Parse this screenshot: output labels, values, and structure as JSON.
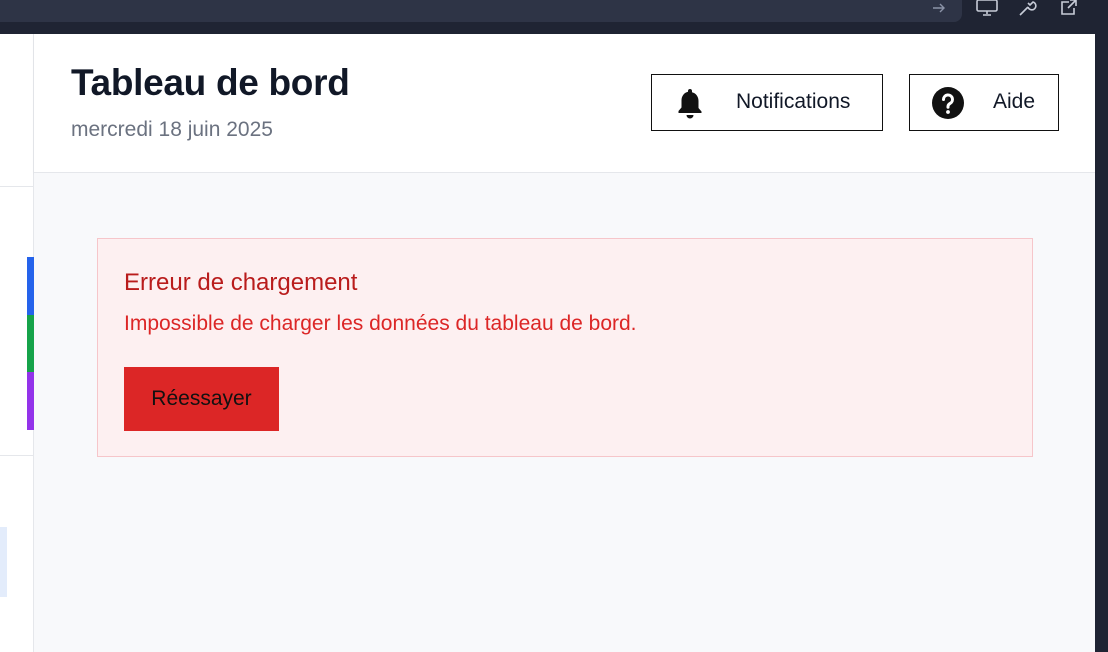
{
  "header": {
    "title": "Tableau de bord",
    "date": "mercredi 18 juin 2025",
    "notifications_label": "Notifications",
    "help_label": "Aide"
  },
  "error": {
    "title": "Erreur de chargement",
    "message": "Impossible de charger les données du tableau de bord.",
    "retry_label": "Réessayer"
  },
  "colors": {
    "error_text": "#b91c1c",
    "error_message": "#dc2626",
    "error_bg": "#fdf0f1",
    "retry_button": "#dc2626",
    "sidebar_accents": [
      "#2563eb",
      "#16a34a",
      "#9333ea"
    ]
  },
  "icons": {
    "notifications": "bell-icon",
    "help": "help-circle-icon",
    "chrome": [
      "arrow-right-icon",
      "monitor-icon",
      "wrench-icon",
      "external-link-icon"
    ]
  }
}
